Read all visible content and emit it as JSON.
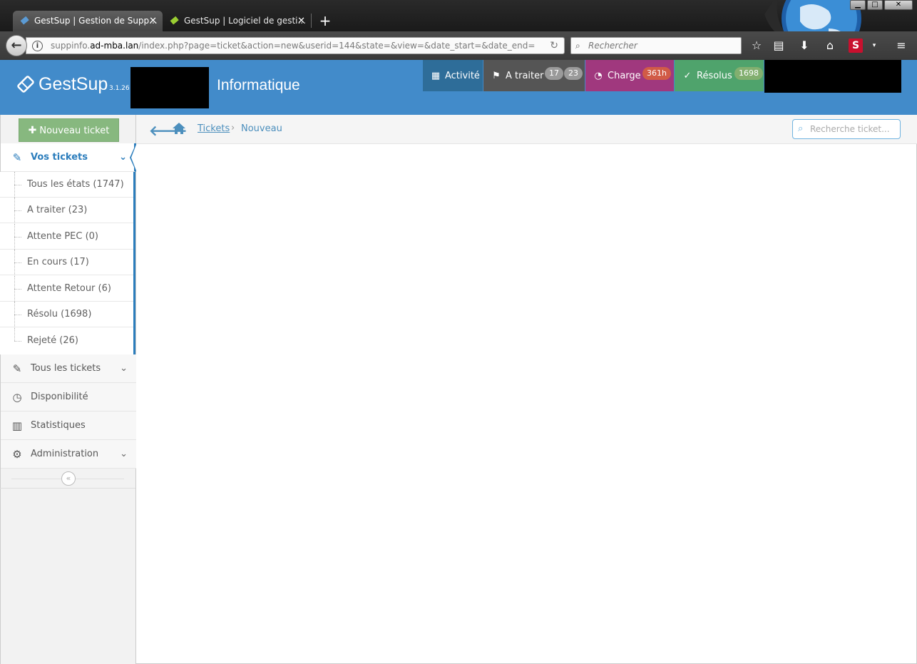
{
  "browser": {
    "tabs": [
      {
        "title": "GestSup | Gestion de Supp...",
        "active": true
      },
      {
        "title": "GestSup | Logiciel de gesti...",
        "active": false
      }
    ],
    "new_tab": "+",
    "url_prefix": "suppinfo.",
    "url_host": "ad-mba.lan",
    "url_path": "/index.php?page=ticket&action=new&userid=144&state=&view=&date_start=&date_end=",
    "search_placeholder": "Rechercher"
  },
  "header": {
    "brand": "GestSup",
    "version": "3.1.26",
    "title": "Informatique",
    "tabs": {
      "activite": {
        "label": "Activité",
        "icon": "calendar-icon"
      },
      "atraiter": {
        "label": "A traiter",
        "badge1": "17",
        "badge2": "23",
        "icon": "flag-icon"
      },
      "charge": {
        "label": "Charge",
        "badge": "361h",
        "icon": "dashboard-icon"
      },
      "resolus": {
        "label": "Résolus",
        "badge": "1698",
        "icon": "check-circle-icon"
      }
    },
    "colors": {
      "header": "#428bca",
      "activite": "#2e6d99",
      "atraiter": "#555555",
      "charge": "#a0387e",
      "resolus": "#4fa36c"
    }
  },
  "sidebar": {
    "new_ticket": "Nouveau ticket",
    "vos_tickets": "Vos tickets",
    "sub_items": [
      "Tous les états (1747)",
      "A traiter (23)",
      "Attente PEC (0)",
      "En cours (17)",
      "Attente Retour (6)",
      "Résolu (1698)",
      "Rejeté (26)"
    ],
    "menu": {
      "tous_tickets": "Tous les tickets",
      "disponibilite": "Disponibilité",
      "statistiques": "Statistiques",
      "administration": "Administration"
    }
  },
  "breadcrumb": {
    "tickets": "Tickets",
    "separator": "›",
    "current": "Nouveau"
  },
  "search": {
    "placeholder": "Recherche ticket..."
  }
}
